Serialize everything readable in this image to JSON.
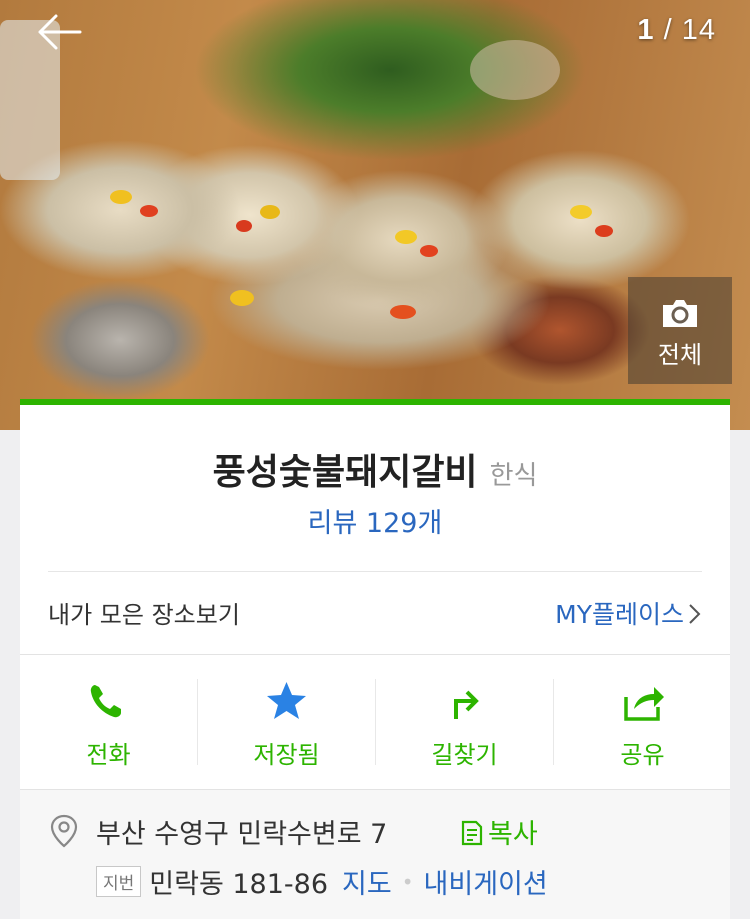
{
  "photo": {
    "current": "1",
    "separator": " / ",
    "total": "14",
    "view_all_label": "전체",
    "icons": {
      "back": "arrow-left-icon",
      "camera": "camera-icon"
    }
  },
  "place": {
    "name": "풍성숯불돼지갈비",
    "category": "한식",
    "review_label": "리뷰 129개"
  },
  "myplace": {
    "text": "내가 모은 장소보기",
    "link_label": "MY플레이스"
  },
  "actions": [
    {
      "label": "전화",
      "icon": "phone-icon"
    },
    {
      "label": "저장됨",
      "icon": "star-icon"
    },
    {
      "label": "길찾기",
      "icon": "directions-icon"
    },
    {
      "label": "공유",
      "icon": "share-icon"
    }
  ],
  "address": {
    "road": "부산 수영구 민락수변로 7",
    "copy_label": "복사",
    "jibun_badge": "지번",
    "jibun": "민락동 181-86",
    "map_label": "지도",
    "navigation_label": "내비게이션"
  },
  "colors": {
    "accent_green": "#2db400",
    "link_blue": "#2a67bf"
  }
}
